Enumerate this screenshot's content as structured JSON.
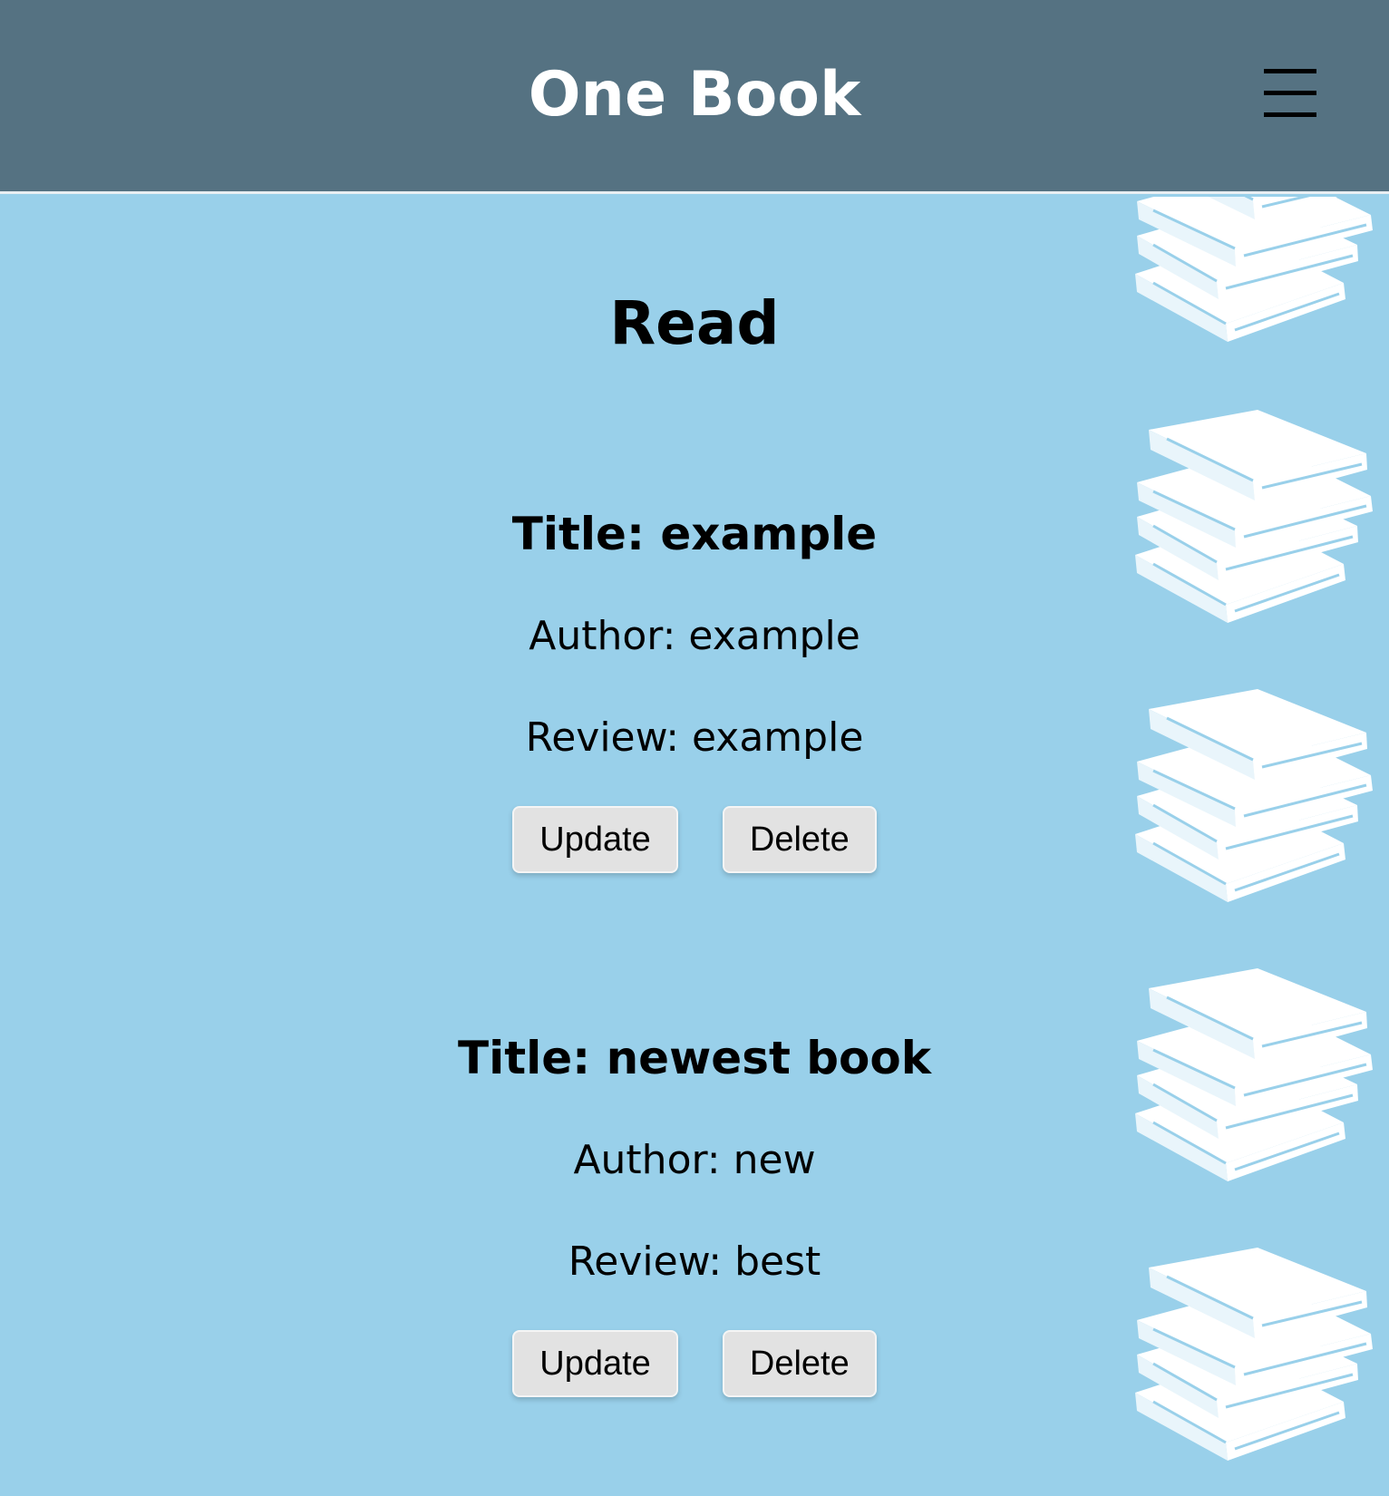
{
  "header": {
    "app_title": "One Book",
    "menu_icon": "hamburger-menu-icon"
  },
  "main": {
    "heading": "Read",
    "books": [
      {
        "title": "Title: example",
        "author": "Author: example",
        "review": "Review: example",
        "update_label": "Update",
        "delete_label": "Delete"
      },
      {
        "title": "Title: newest book",
        "author": "Author: new",
        "review": "Review: best",
        "update_label": "Update",
        "delete_label": "Delete"
      }
    ]
  },
  "decoration": {
    "icon": "book-stack-icon",
    "color": "#ffffff"
  },
  "colors": {
    "header_bg": "#557282",
    "page_bg": "#99d0ea",
    "button_bg": "#e2e2e2"
  }
}
